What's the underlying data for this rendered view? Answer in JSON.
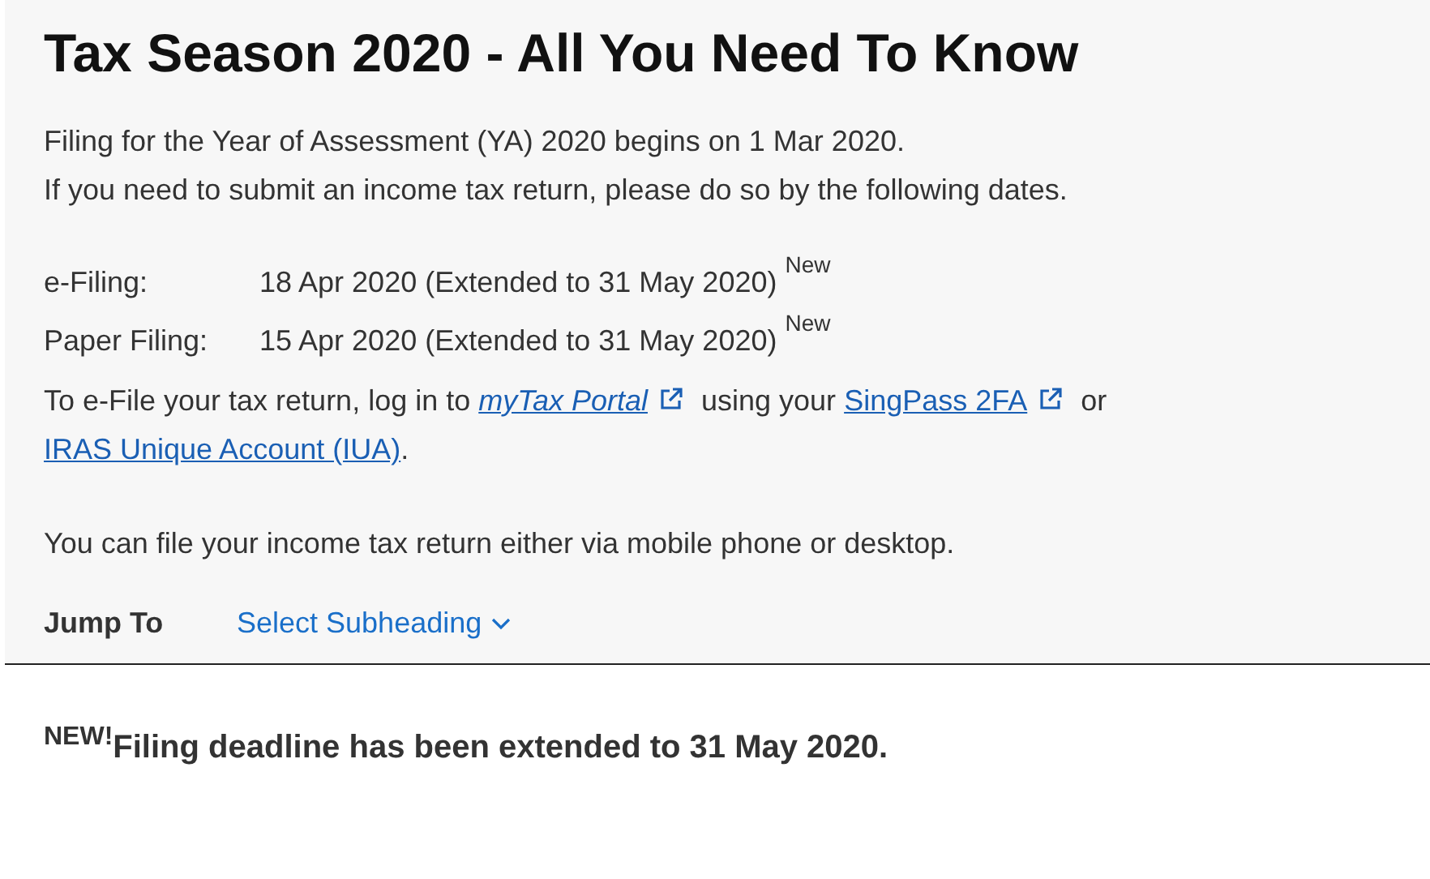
{
  "title": "Tax Season 2020 - All You Need To Know",
  "intro": [
    "Filing for the Year of Assessment (YA) 2020 begins on 1 Mar 2020.",
    "If you need to submit an income tax return, please do so by the following dates."
  ],
  "deadlines": [
    {
      "label": "e-Filing:",
      "date": "18 Apr 2020 (Extended to 31 May 2020)",
      "badge": "New"
    },
    {
      "label": "Paper Filing:",
      "date": "15 Apr 2020 (Extended to 31 May 2020)",
      "badge": "New"
    }
  ],
  "login_paragraph": [
    {
      "kind": "text",
      "text": "To e-File your tax return, log in to "
    },
    {
      "kind": "link",
      "text": "myTax Portal",
      "italic": true,
      "external": true
    },
    {
      "kind": "text",
      "text": " using your "
    },
    {
      "kind": "link",
      "text": "SingPass 2FA",
      "italic": false,
      "external": true
    },
    {
      "kind": "text",
      "text": " or "
    },
    {
      "kind": "link",
      "text": "IRAS Unique Account (IUA)",
      "italic": false,
      "external": false
    },
    {
      "kind": "text",
      "text": "."
    }
  ],
  "device_note": "You can file your income tax return either via mobile phone or desktop.",
  "jump_to": {
    "label": "Jump To",
    "select": "Select Subheading"
  },
  "notice": {
    "badge": "NEW!",
    "text": "Filing deadline has been extended to 31 May 2020."
  }
}
